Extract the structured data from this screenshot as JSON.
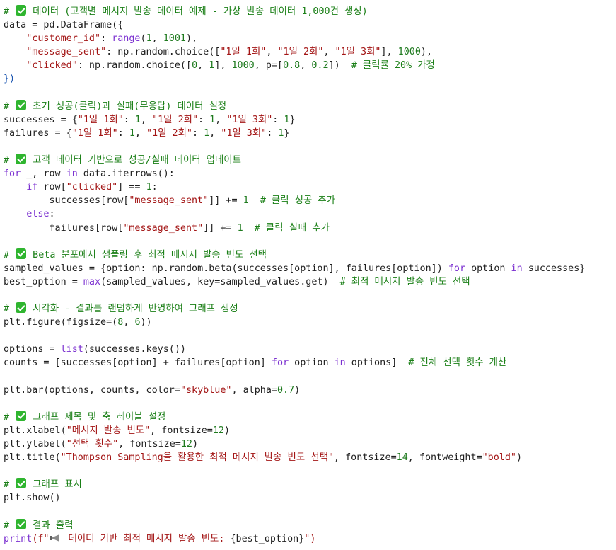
{
  "code": {
    "language": "python",
    "lines": [
      [
        {
          "t": "# ",
          "c": "c"
        },
        {
          "i": "check"
        },
        {
          "t": " 데이터 (고객별 메시지 발송 데이터 예제 - 가상 발송 데이터 1,000건 생성)",
          "c": "c"
        }
      ],
      [
        {
          "t": "data = pd.DataFrame({",
          "c": "p"
        }
      ],
      [
        {
          "t": "    ",
          "c": "p"
        },
        {
          "t": "\"customer_id\"",
          "c": "s"
        },
        {
          "t": ": ",
          "c": "p"
        },
        {
          "t": "range",
          "c": "k"
        },
        {
          "t": "(",
          "c": "p"
        },
        {
          "t": "1",
          "c": "n"
        },
        {
          "t": ", ",
          "c": "p"
        },
        {
          "t": "1001",
          "c": "n"
        },
        {
          "t": "),",
          "c": "p"
        }
      ],
      [
        {
          "t": "    ",
          "c": "p"
        },
        {
          "t": "\"message_sent\"",
          "c": "s"
        },
        {
          "t": ": np.random.choice([",
          "c": "p"
        },
        {
          "t": "\"1일 1회\"",
          "c": "s"
        },
        {
          "t": ", ",
          "c": "p"
        },
        {
          "t": "\"1일 2회\"",
          "c": "s"
        },
        {
          "t": ", ",
          "c": "p"
        },
        {
          "t": "\"1일 3회\"",
          "c": "s"
        },
        {
          "t": "], ",
          "c": "p"
        },
        {
          "t": "1000",
          "c": "n"
        },
        {
          "t": "),",
          "c": "p"
        }
      ],
      [
        {
          "t": "    ",
          "c": "p"
        },
        {
          "t": "\"clicked\"",
          "c": "s"
        },
        {
          "t": ": np.random.choice([",
          "c": "p"
        },
        {
          "t": "0",
          "c": "n"
        },
        {
          "t": ", ",
          "c": "p"
        },
        {
          "t": "1",
          "c": "n"
        },
        {
          "t": "], ",
          "c": "p"
        },
        {
          "t": "1000",
          "c": "n"
        },
        {
          "t": ", p=[",
          "c": "p"
        },
        {
          "t": "0.8",
          "c": "n"
        },
        {
          "t": ", ",
          "c": "p"
        },
        {
          "t": "0.2",
          "c": "n"
        },
        {
          "t": "])  ",
          "c": "p"
        },
        {
          "t": "# 클릭률 20% 가정",
          "c": "c"
        }
      ],
      [
        {
          "t": "})",
          "c": "b"
        }
      ],
      [],
      [
        {
          "t": "# ",
          "c": "c"
        },
        {
          "i": "check"
        },
        {
          "t": " 초기 성공(클릭)과 실패(무응답) 데이터 설정",
          "c": "c"
        }
      ],
      [
        {
          "t": "successes = {",
          "c": "p"
        },
        {
          "t": "\"1일 1회\"",
          "c": "s"
        },
        {
          "t": ": ",
          "c": "p"
        },
        {
          "t": "1",
          "c": "n"
        },
        {
          "t": ", ",
          "c": "p"
        },
        {
          "t": "\"1일 2회\"",
          "c": "s"
        },
        {
          "t": ": ",
          "c": "p"
        },
        {
          "t": "1",
          "c": "n"
        },
        {
          "t": ", ",
          "c": "p"
        },
        {
          "t": "\"1일 3회\"",
          "c": "s"
        },
        {
          "t": ": ",
          "c": "p"
        },
        {
          "t": "1",
          "c": "n"
        },
        {
          "t": "}",
          "c": "p"
        }
      ],
      [
        {
          "t": "failures = {",
          "c": "p"
        },
        {
          "t": "\"1일 1회\"",
          "c": "s"
        },
        {
          "t": ": ",
          "c": "p"
        },
        {
          "t": "1",
          "c": "n"
        },
        {
          "t": ", ",
          "c": "p"
        },
        {
          "t": "\"1일 2회\"",
          "c": "s"
        },
        {
          "t": ": ",
          "c": "p"
        },
        {
          "t": "1",
          "c": "n"
        },
        {
          "t": ", ",
          "c": "p"
        },
        {
          "t": "\"1일 3회\"",
          "c": "s"
        },
        {
          "t": ": ",
          "c": "p"
        },
        {
          "t": "1",
          "c": "n"
        },
        {
          "t": "}",
          "c": "p"
        }
      ],
      [],
      [
        {
          "t": "# ",
          "c": "c"
        },
        {
          "i": "check"
        },
        {
          "t": " 고객 데이터 기반으로 성공/실패 데이터 업데이트",
          "c": "c"
        }
      ],
      [
        {
          "t": "for",
          "c": "k"
        },
        {
          "t": " _, row ",
          "c": "p"
        },
        {
          "t": "in",
          "c": "k"
        },
        {
          "t": " data.iterrows():",
          "c": "p"
        }
      ],
      [
        {
          "t": "    ",
          "c": "p"
        },
        {
          "t": "if",
          "c": "k"
        },
        {
          "t": " row[",
          "c": "p"
        },
        {
          "t": "\"clicked\"",
          "c": "s"
        },
        {
          "t": "] == ",
          "c": "p"
        },
        {
          "t": "1",
          "c": "n"
        },
        {
          "t": ":",
          "c": "p"
        }
      ],
      [
        {
          "t": "        successes[row[",
          "c": "p"
        },
        {
          "t": "\"message_sent\"",
          "c": "s"
        },
        {
          "t": "]] += ",
          "c": "p"
        },
        {
          "t": "1",
          "c": "n"
        },
        {
          "t": "  ",
          "c": "p"
        },
        {
          "t": "# 클릭 성공 추가",
          "c": "c"
        }
      ],
      [
        {
          "t": "    ",
          "c": "p"
        },
        {
          "t": "else",
          "c": "k"
        },
        {
          "t": ":",
          "c": "p"
        }
      ],
      [
        {
          "t": "        failures[row[",
          "c": "p"
        },
        {
          "t": "\"message_sent\"",
          "c": "s"
        },
        {
          "t": "]] += ",
          "c": "p"
        },
        {
          "t": "1",
          "c": "n"
        },
        {
          "t": "  ",
          "c": "p"
        },
        {
          "t": "# 클릭 실패 추가",
          "c": "c"
        }
      ],
      [],
      [
        {
          "t": "# ",
          "c": "c"
        },
        {
          "i": "check"
        },
        {
          "t": " Beta 분포에서 샘플링 후 최적 메시지 발송 빈도 선택",
          "c": "c"
        }
      ],
      [
        {
          "t": "sampled_values = {option: np.random.beta(successes[option], failures[option]) ",
          "c": "p"
        },
        {
          "t": "for",
          "c": "k"
        },
        {
          "t": " option ",
          "c": "p"
        },
        {
          "t": "in",
          "c": "k"
        },
        {
          "t": " successes}",
          "c": "p"
        }
      ],
      [
        {
          "t": "best_option = ",
          "c": "p"
        },
        {
          "t": "max",
          "c": "k"
        },
        {
          "t": "(sampled_values, key=sampled_values.get)  ",
          "c": "p"
        },
        {
          "t": "# 최적 메시지 발송 빈도 선택",
          "c": "c"
        }
      ],
      [],
      [
        {
          "t": "# ",
          "c": "c"
        },
        {
          "i": "check"
        },
        {
          "t": " 시각화 - 결과를 랜덤하게 반영하여 그래프 생성",
          "c": "c"
        }
      ],
      [
        {
          "t": "plt.figure(figsize=(",
          "c": "p"
        },
        {
          "t": "8",
          "c": "n"
        },
        {
          "t": ", ",
          "c": "p"
        },
        {
          "t": "6",
          "c": "n"
        },
        {
          "t": "))",
          "c": "p"
        }
      ],
      [],
      [
        {
          "t": "options = ",
          "c": "p"
        },
        {
          "t": "list",
          "c": "k"
        },
        {
          "t": "(successes.keys())",
          "c": "p"
        }
      ],
      [
        {
          "t": "counts = [successes[option] + failures[option] ",
          "c": "p"
        },
        {
          "t": "for",
          "c": "k"
        },
        {
          "t": " option ",
          "c": "p"
        },
        {
          "t": "in",
          "c": "k"
        },
        {
          "t": " options]  ",
          "c": "p"
        },
        {
          "t": "# 전체 선택 횟수 계산",
          "c": "c"
        }
      ],
      [],
      [
        {
          "t": "plt.bar(options, counts, color=",
          "c": "p"
        },
        {
          "t": "\"skyblue\"",
          "c": "s"
        },
        {
          "t": ", alpha=",
          "c": "p"
        },
        {
          "t": "0.7",
          "c": "n"
        },
        {
          "t": ")",
          "c": "p"
        }
      ],
      [],
      [
        {
          "t": "# ",
          "c": "c"
        },
        {
          "i": "check"
        },
        {
          "t": " 그래프 제목 및 축 레이블 설정",
          "c": "c"
        }
      ],
      [
        {
          "t": "plt.xlabel(",
          "c": "p"
        },
        {
          "t": "\"메시지 발송 빈도\"",
          "c": "s"
        },
        {
          "t": ", fontsize=",
          "c": "p"
        },
        {
          "t": "12",
          "c": "n"
        },
        {
          "t": ")",
          "c": "p"
        }
      ],
      [
        {
          "t": "plt.ylabel(",
          "c": "p"
        },
        {
          "t": "\"선택 횟수\"",
          "c": "s"
        },
        {
          "t": ", fontsize=",
          "c": "p"
        },
        {
          "t": "12",
          "c": "n"
        },
        {
          "t": ")",
          "c": "p"
        }
      ],
      [
        {
          "t": "plt.title(",
          "c": "p"
        },
        {
          "t": "\"Thompson Sampling을 활용한 최적 메시지 발송 빈도 선택\"",
          "c": "s"
        },
        {
          "t": ", fontsize=",
          "c": "p"
        },
        {
          "t": "14",
          "c": "n"
        },
        {
          "t": ", fontweight=",
          "c": "p"
        },
        {
          "t": "\"bold\"",
          "c": "s"
        },
        {
          "t": ")",
          "c": "p"
        }
      ],
      [],
      [
        {
          "t": "# ",
          "c": "c"
        },
        {
          "i": "check"
        },
        {
          "t": " 그래프 표시",
          "c": "c"
        }
      ],
      [
        {
          "t": "plt.show()",
          "c": "p"
        }
      ],
      [],
      [
        {
          "t": "# ",
          "c": "c"
        },
        {
          "i": "check"
        },
        {
          "t": " 결과 출력",
          "c": "c"
        }
      ],
      [
        {
          "t": "print",
          "c": "k"
        },
        {
          "t": "(f\"",
          "c": "s"
        },
        {
          "i": "mega"
        },
        {
          "t": " 데이터 기반 최적 메시지 발송 빈도: ",
          "c": "s"
        },
        {
          "t": "{best_option}",
          "c": "p"
        },
        {
          "t": "\")",
          "c": "s"
        }
      ]
    ]
  },
  "colors": {
    "keyword": "#7b30d0",
    "string": "#a31515",
    "comment": "#1a7f16",
    "number": "#1e7a1e",
    "bracket": "#1a55b0",
    "plain": "#1f1f1f",
    "check_badge": "#2fb52f"
  },
  "icons": {
    "check": "check-mark-icon",
    "mega": "megaphone-icon"
  }
}
